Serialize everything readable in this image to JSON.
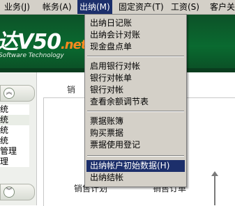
{
  "menubar": {
    "items": [
      {
        "label": "业务(J)"
      },
      {
        "label": "帐务(A)"
      },
      {
        "label": "出纳(M)"
      },
      {
        "label": "固定资产(T)"
      },
      {
        "label": "工资(S)"
      },
      {
        "label": "客户关"
      }
    ]
  },
  "banner": {
    "logo": "达V50",
    "logo_suffix": ".net",
    "subtitle": "Software Technology"
  },
  "left_panel": {
    "items": [
      "统",
      "统",
      "统",
      "统",
      "管理",
      "理"
    ]
  },
  "content": {
    "tab_label": "销",
    "labels": [
      "销售计划",
      "销售订单"
    ]
  },
  "dropdown": {
    "items": [
      "出纳日记账",
      "出纳会计对账",
      "现金盘点单",
      "启用银行对帐",
      "银行对帐单",
      "银行对帐",
      "查看余额调节表",
      "票据账簿",
      "购买票据",
      "票据使用登记",
      "出纳帐户初始数据(H)",
      "出纳结帐"
    ],
    "highlighted_index": 10
  },
  "colors": {
    "menu_bg": "#d4d0c8",
    "highlight": "#1c2f6b",
    "banner_green": "#0a6a30",
    "logo_accent": "#ff8a1e"
  }
}
